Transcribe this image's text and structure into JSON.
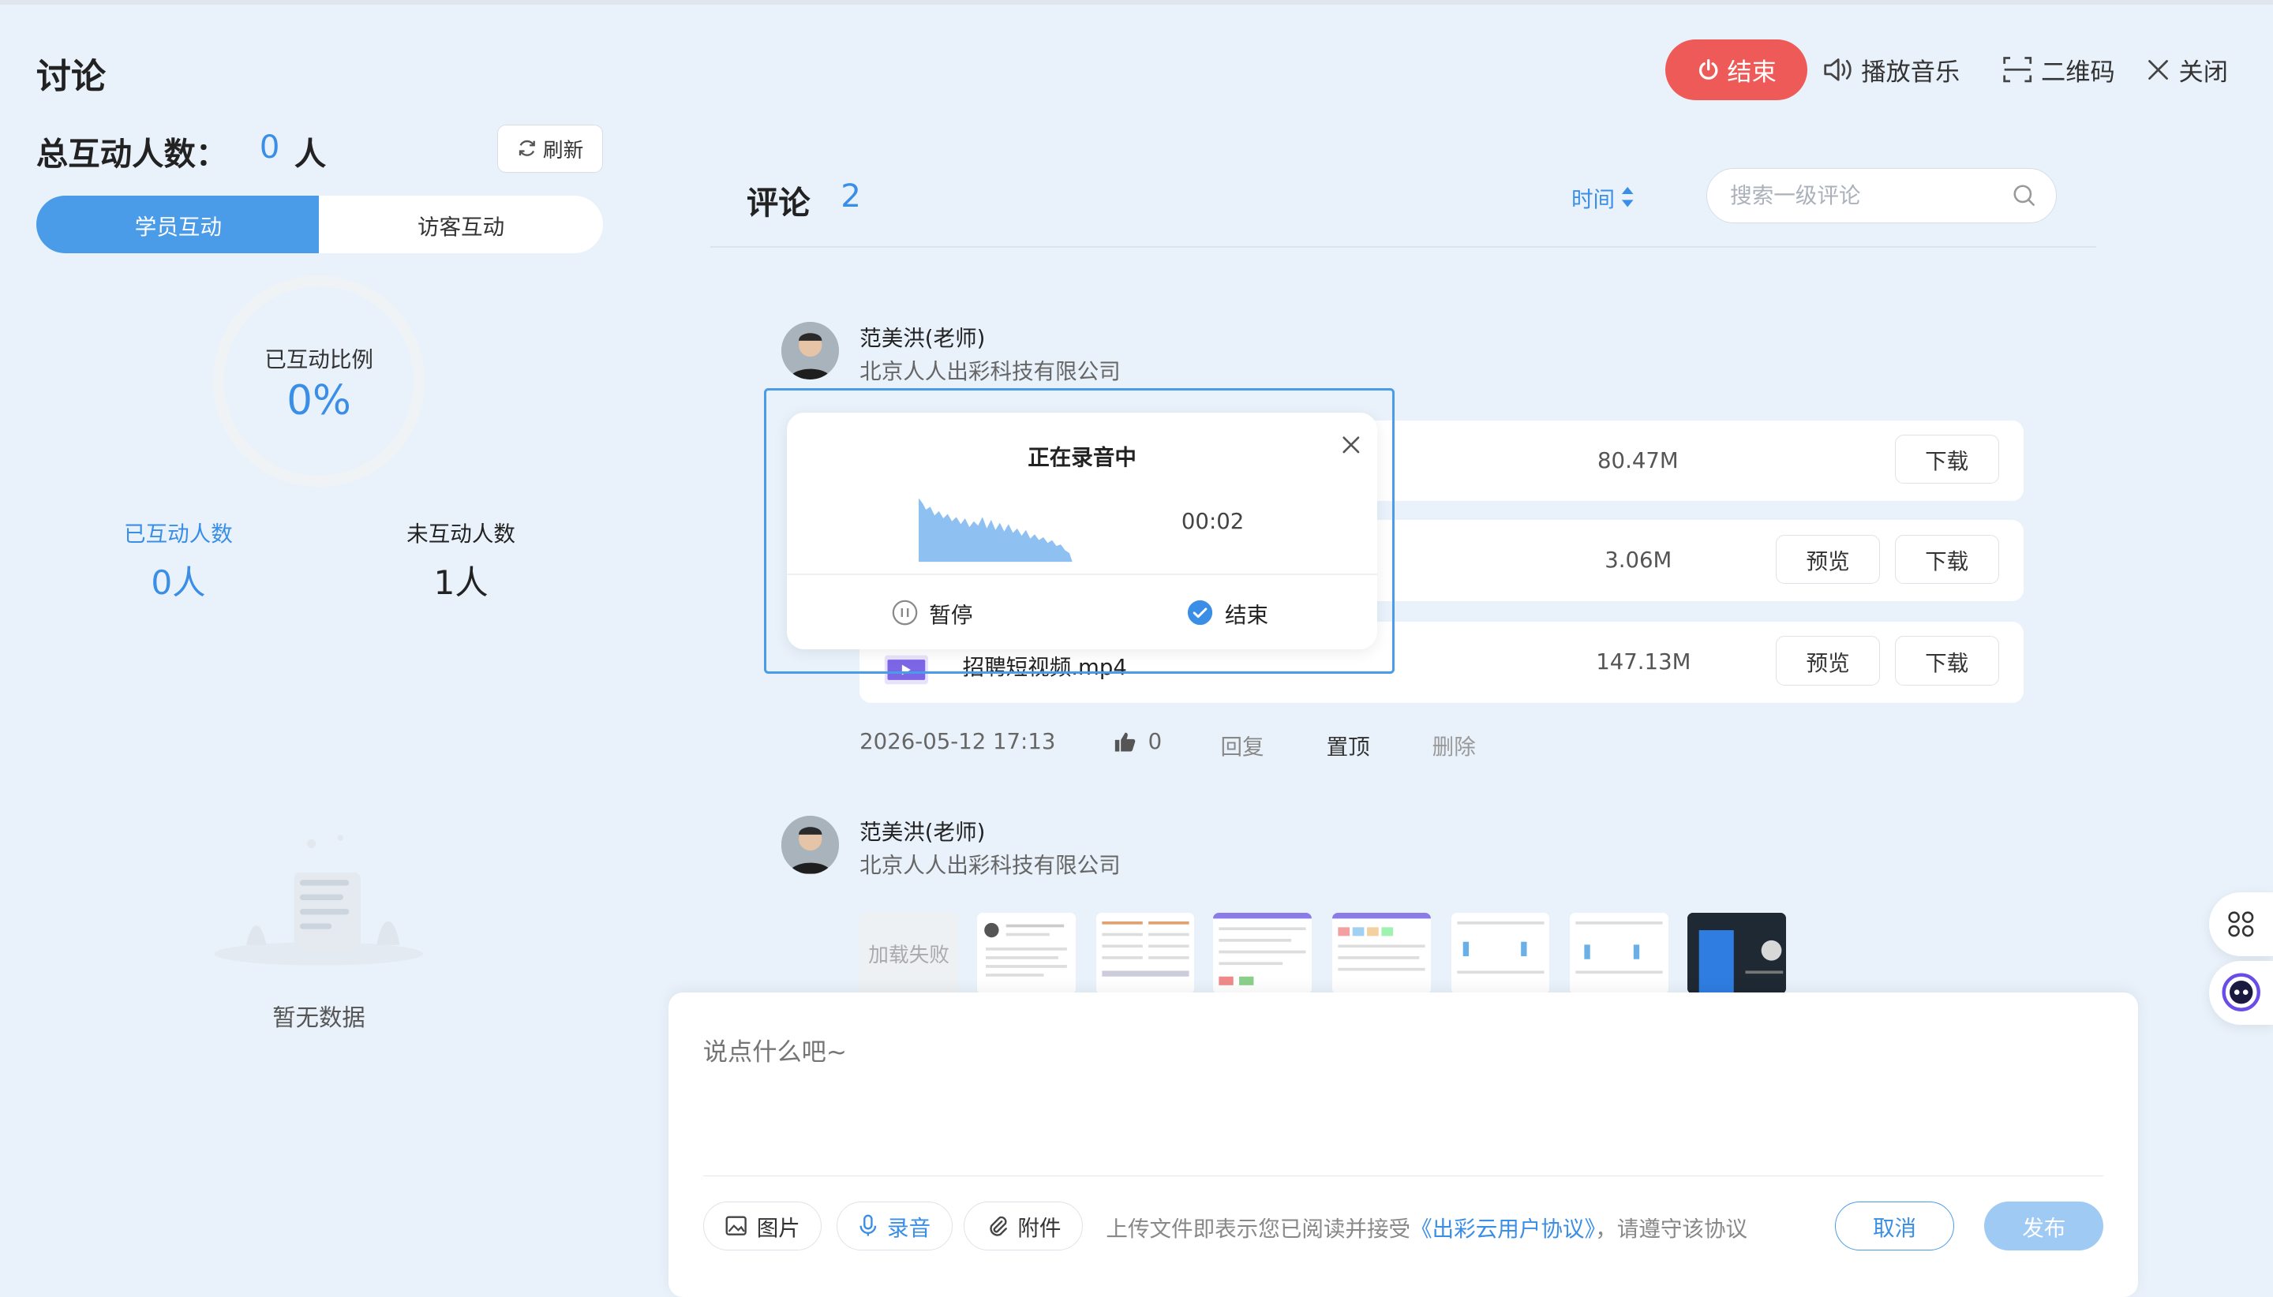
{
  "header": {
    "title": "讨论",
    "end_label": "结束",
    "play_music_label": "播放音乐",
    "qr_label": "二维码",
    "close_label": "关闭"
  },
  "left_panel": {
    "total_label": "总互动人数：",
    "total_value": "0",
    "total_unit": "人",
    "refresh_label": "刷新",
    "tabs": [
      {
        "label": "学员互动",
        "active": true
      },
      {
        "label": "访客互动",
        "active": false
      }
    ],
    "ring_label": "已互动比例",
    "ring_value": "0%",
    "interacted_label": "已互动人数",
    "interacted_value": "0人",
    "not_interacted_label": "未互动人数",
    "not_interacted_value": "1人",
    "empty_text": "暂无数据"
  },
  "comments": {
    "title": "评论",
    "count": "2",
    "sort_label": "时间",
    "search_placeholder": "搜索一级评论",
    "items": [
      {
        "author": "范美洪(老师)",
        "company": "北京人人出彩科技有限公司",
        "files": [
          {
            "name": "",
            "size": "80.47M",
            "download": "下载"
          },
          {
            "name": "",
            "size": "3.06M",
            "preview": "预览",
            "download": "下载"
          },
          {
            "name": "招聘短视频.mp4",
            "size": "147.13M",
            "preview": "预览",
            "download": "下载"
          }
        ],
        "time": "2026-05-12 17:13",
        "likes": "0",
        "reply": "回复",
        "pin": "置顶",
        "delete": "删除"
      },
      {
        "author": "范美洪(老师)",
        "company": "北京人人出彩科技有限公司",
        "failed_label": "加载失败"
      }
    ]
  },
  "recording": {
    "title": "正在录音中",
    "time": "00:02",
    "pause_label": "暂停",
    "end_label": "结束"
  },
  "compose": {
    "placeholder": "说点什么吧~",
    "image_label": "图片",
    "record_label": "录音",
    "attach_label": "附件",
    "notice_prefix": "上传文件即表示您已阅读并接受",
    "notice_link": "《出彩云用户协议》",
    "notice_suffix": "，请遵守该协议",
    "cancel_label": "取消",
    "publish_label": "发布"
  },
  "colors": {
    "accent": "#3a8ee6",
    "end_red": "#ee5a57",
    "background": "#e9f2fb"
  }
}
